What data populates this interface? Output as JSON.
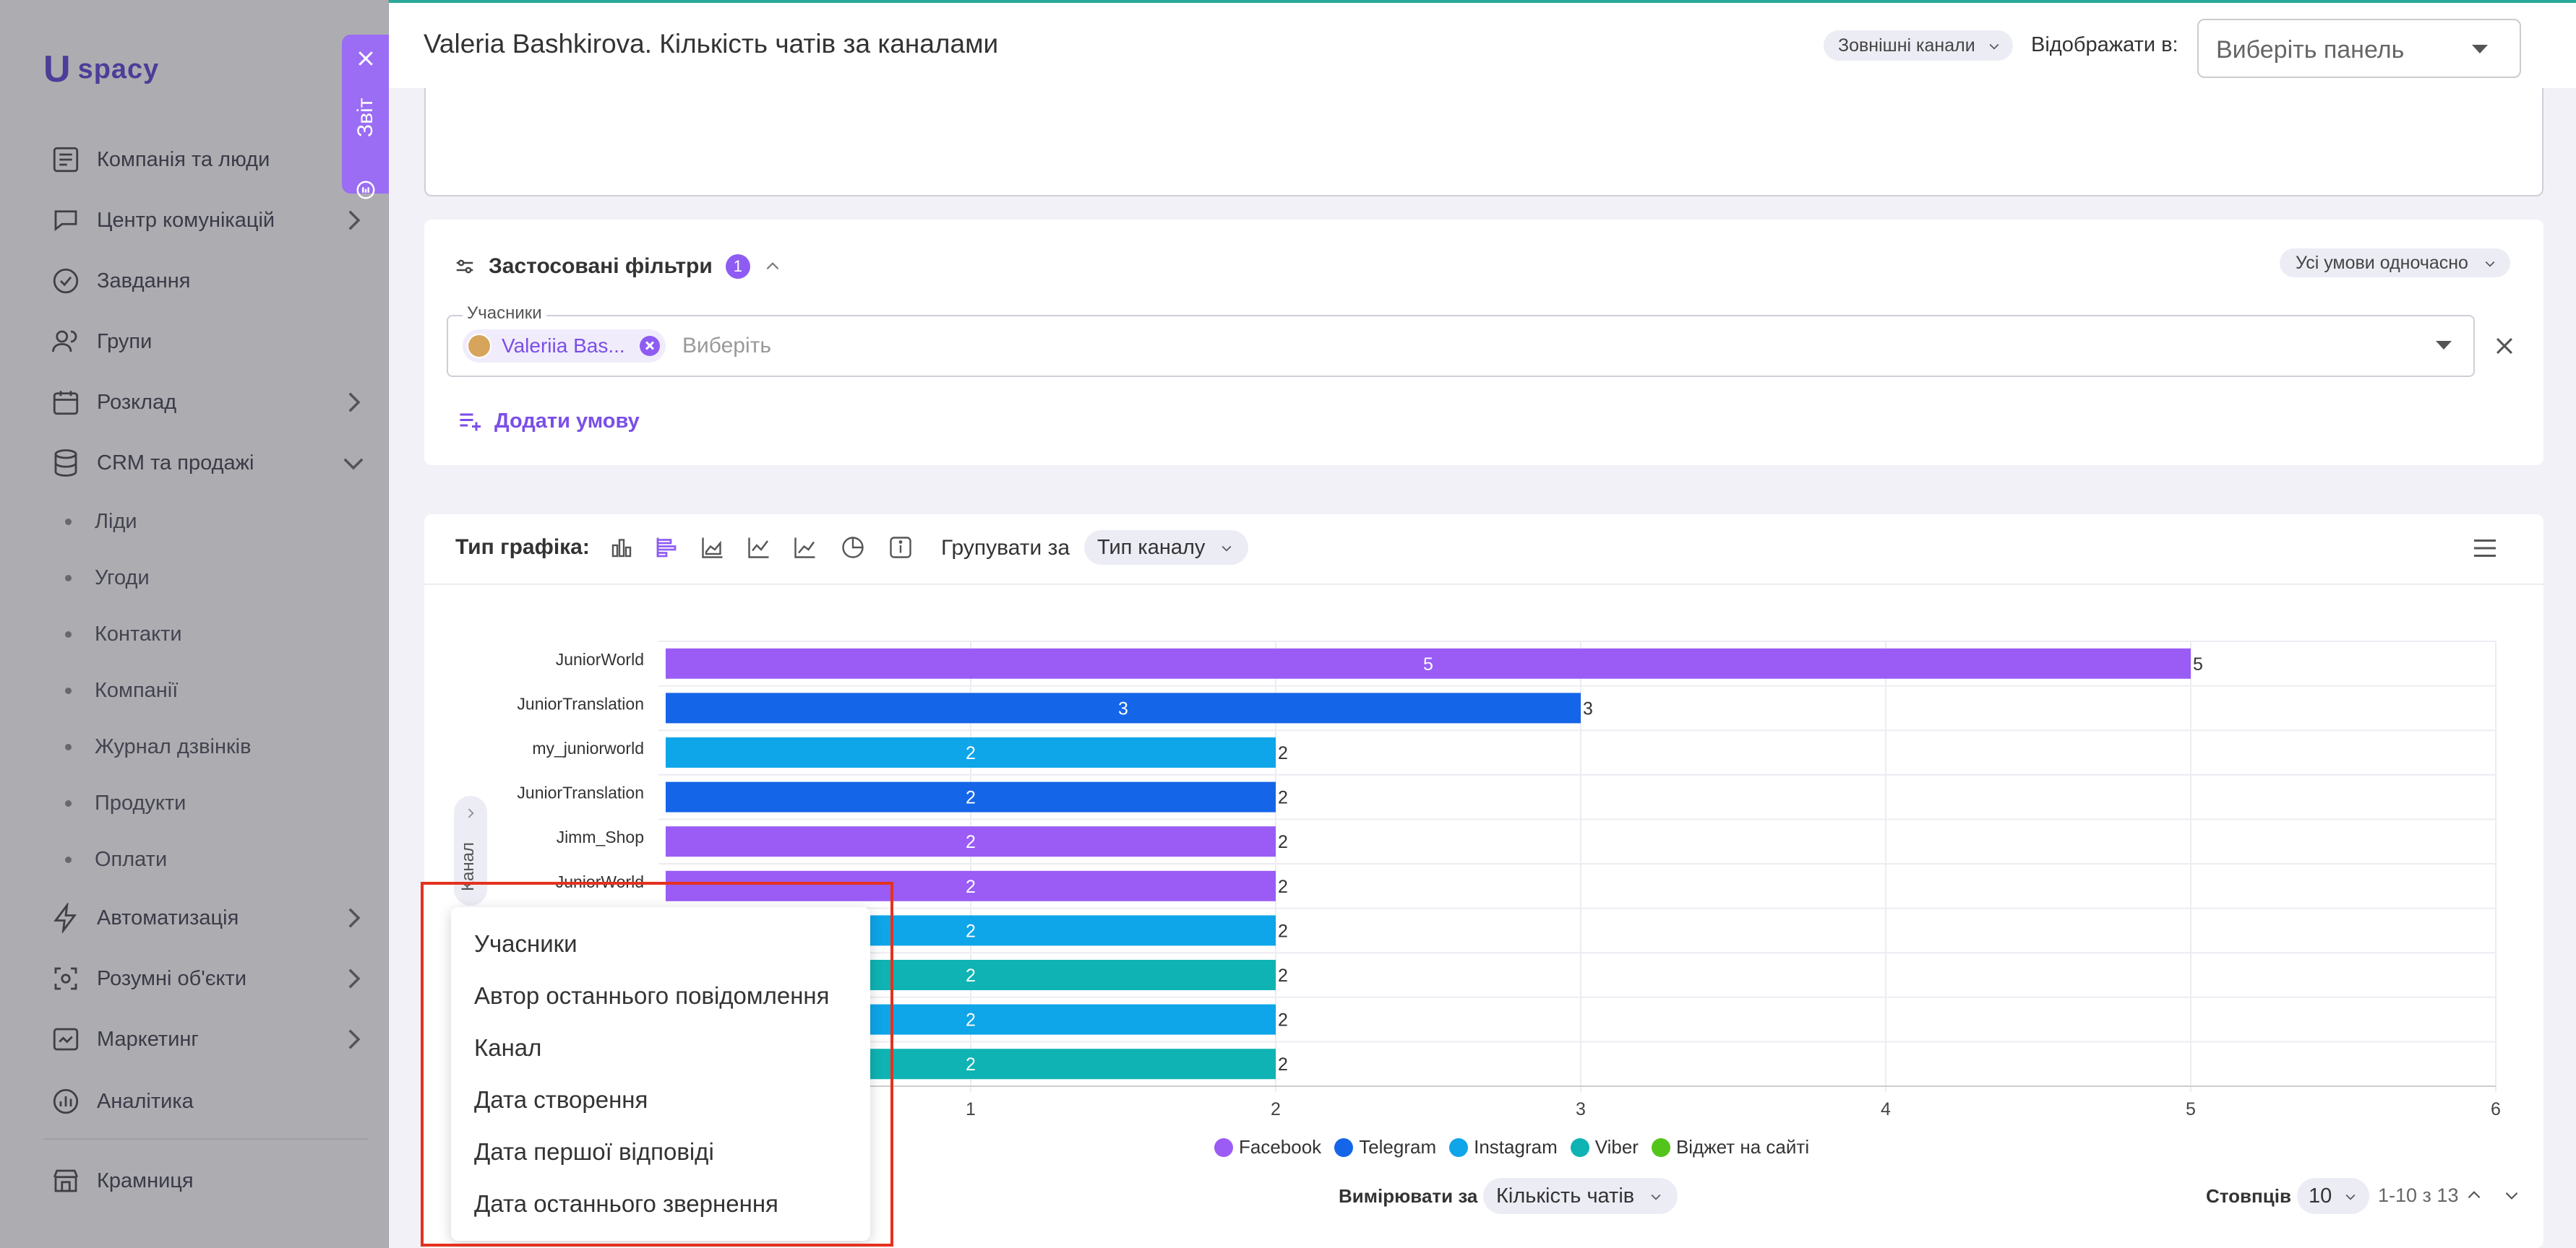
{
  "app": {
    "logo_mark": "U",
    "logo_text": "spacy"
  },
  "sidebar": {
    "items": [
      {
        "label": "Компанія та люди",
        "icon": "company-icon",
        "has_arrow": false
      },
      {
        "label": "Центр комунікацій",
        "icon": "communications-icon",
        "has_arrow": true
      },
      {
        "label": "Завдання",
        "icon": "tasks-icon",
        "has_arrow": false
      },
      {
        "label": "Групи",
        "icon": "groups-icon",
        "has_arrow": false
      },
      {
        "label": "Розклад",
        "icon": "calendar-icon",
        "has_arrow": true
      },
      {
        "label": "CRM та продажі",
        "icon": "database-icon",
        "has_arrow": true,
        "expanded": true
      }
    ],
    "subitems": [
      "Ліди",
      "Угоди",
      "Контакти",
      "Компанії",
      "Журнал дзвінків",
      "Продукти",
      "Оплати"
    ],
    "items2": [
      {
        "label": "Автоматизація",
        "icon": "automation-icon",
        "has_arrow": true
      },
      {
        "label": "Розумні об'єкти",
        "icon": "smart-objects-icon",
        "has_arrow": true
      },
      {
        "label": "Маркетинг",
        "icon": "marketing-icon",
        "has_arrow": true
      },
      {
        "label": "Аналітика",
        "icon": "analytics-icon",
        "has_arrow": false
      }
    ],
    "store": {
      "label": "Крамниця",
      "icon": "store-icon"
    }
  },
  "report_tab": {
    "label": "Звіт"
  },
  "header": {
    "title": "Valeria Bashkirova. Кількість чатів за каналами",
    "external_channels": "Зовнішні канали",
    "show_in_label": "Відображати в:",
    "panel_placeholder": "Виберіть панель"
  },
  "filters": {
    "title": "Застосовані фільтри",
    "count": "1",
    "all_conditions": "Усі умови одночасно",
    "participants_label": "Учасники",
    "chip_label": "Valeriia Bas...",
    "choose_placeholder": "Виберіть",
    "add_condition": "Додати умову"
  },
  "chart_toolbar": {
    "chart_type_label": "Тип графіка:",
    "group_by_label": "Групувати за",
    "group_by_value": "Тип каналу"
  },
  "chart_data": {
    "type": "bar",
    "orientation": "horizontal",
    "categories": [
      "JuniorWorld",
      "JuniorTranslation",
      "my_juniorworld",
      "JuniorTranslation",
      "Jimm_Shop",
      "JuniorWorld",
      "",
      "",
      "",
      ""
    ],
    "values": [
      5,
      3,
      2,
      2,
      2,
      2,
      2,
      2,
      2,
      2
    ],
    "bar_colors": [
      "#9a5cf5",
      "#1565e8",
      "#0ea5e9",
      "#1565e8",
      "#9a5cf5",
      "#9a5cf5",
      "#0ea5e9",
      "#0fb3b3",
      "#0ea5e9",
      "#0fb3b3"
    ],
    "xlim": [
      0,
      6
    ],
    "xticks": [
      1,
      2,
      3,
      4,
      5,
      6
    ],
    "grid": true,
    "legend": [
      {
        "name": "Facebook",
        "color": "#9a5cf5"
      },
      {
        "name": "Telegram",
        "color": "#1565e8"
      },
      {
        "name": "Instagram",
        "color": "#0ea5e9"
      },
      {
        "name": "Viber",
        "color": "#0fb3b3"
      },
      {
        "name": "Віджет на сайті",
        "color": "#52c41a"
      }
    ],
    "legend_position": "bottom-center"
  },
  "axis_tab": {
    "label": "Канал"
  },
  "dropdown": {
    "items": [
      "Учасники",
      "Автор останнього повідомлення",
      "Канал",
      "Дата створення",
      "Дата першої відповіді",
      "Дата останнього звернення"
    ]
  },
  "footer": {
    "measure_label": "Вимірювати за",
    "measure_value": "Кількість чатів",
    "columns_label": "Стовпців",
    "columns_value": "10",
    "range_text": "1-10 з 13"
  }
}
